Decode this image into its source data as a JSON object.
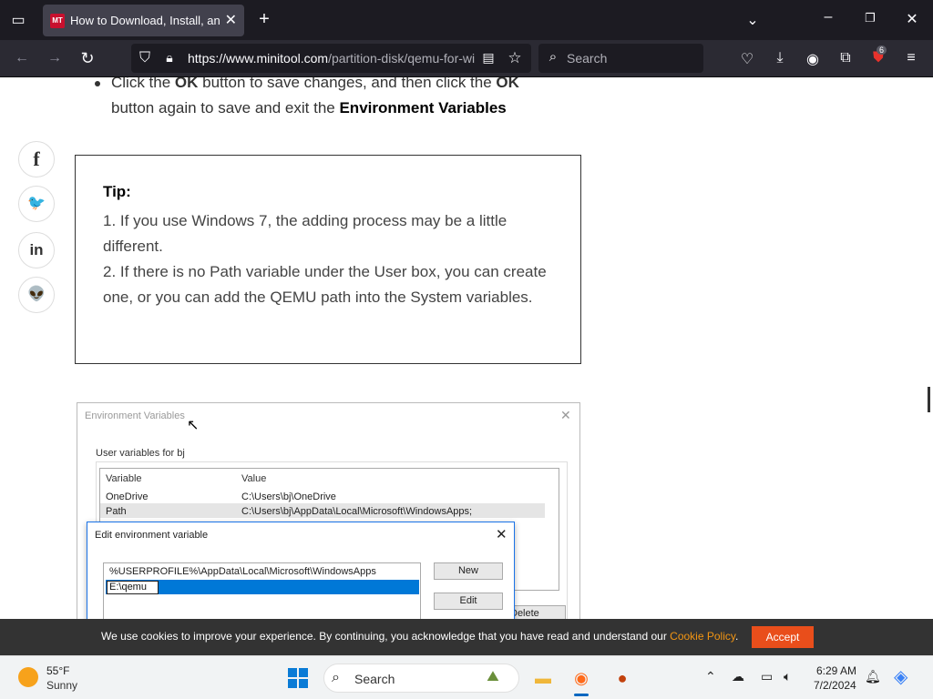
{
  "browser": {
    "tab_title": "How to Download, Install, and Use QEMU",
    "favicon_text": "MT",
    "url_domain": "https://www.minitool.com",
    "url_path": "/partition-disk/qemu-for-windows.html",
    "search_placeholder": "Search",
    "extensions_badge": "6"
  },
  "content": {
    "bullet_part1": "Click the ",
    "bullet_ok1": "OK",
    "bullet_part2": " button to save changes, and then click the ",
    "bullet_ok2": "OK",
    "bullet_part3": " button again to save and exit the ",
    "bullet_env": "Environment Variables",
    "tip_title": "Tip:",
    "tip_line1": "1. If you use Windows 7, the adding process may be a little different.",
    "tip_line2": "2. If there is no Path variable under the User box, you can create one, or you can add the QEMU path into the System variables."
  },
  "social": {
    "facebook": "f",
    "twitter": "🐦",
    "linkedin": "in",
    "reddit": "👽"
  },
  "screenshot": {
    "window_title": "Environment Variables",
    "section_label": "User variables for bj",
    "col_variable": "Variable",
    "col_value": "Value",
    "rows": [
      {
        "variable": "OneDrive",
        "value": "C:\\Users\\bj\\OneDrive"
      },
      {
        "variable": "Path",
        "value": "C:\\Users\\bj\\AppData\\Local\\Microsoft\\WindowsApps;"
      }
    ],
    "delete_label": "Delete",
    "edit_title": "Edit environment variable",
    "edit_entries": [
      "%USERPROFILE%\\AppData\\Local\\Microsoft\\WindowsApps",
      "E:\\qemu"
    ],
    "new_label": "New",
    "edit_label": "Edit"
  },
  "cookie": {
    "text": "We use cookies to improve your experience. By continuing, you acknowledge that you have read and understand our ",
    "link": "Cookie Policy",
    "period": ".",
    "accept": "Accept"
  },
  "taskbar": {
    "temperature": "55°F",
    "condition": "Sunny",
    "search_label": "Search",
    "time": "6:29 AM",
    "date": "7/2/2024"
  }
}
